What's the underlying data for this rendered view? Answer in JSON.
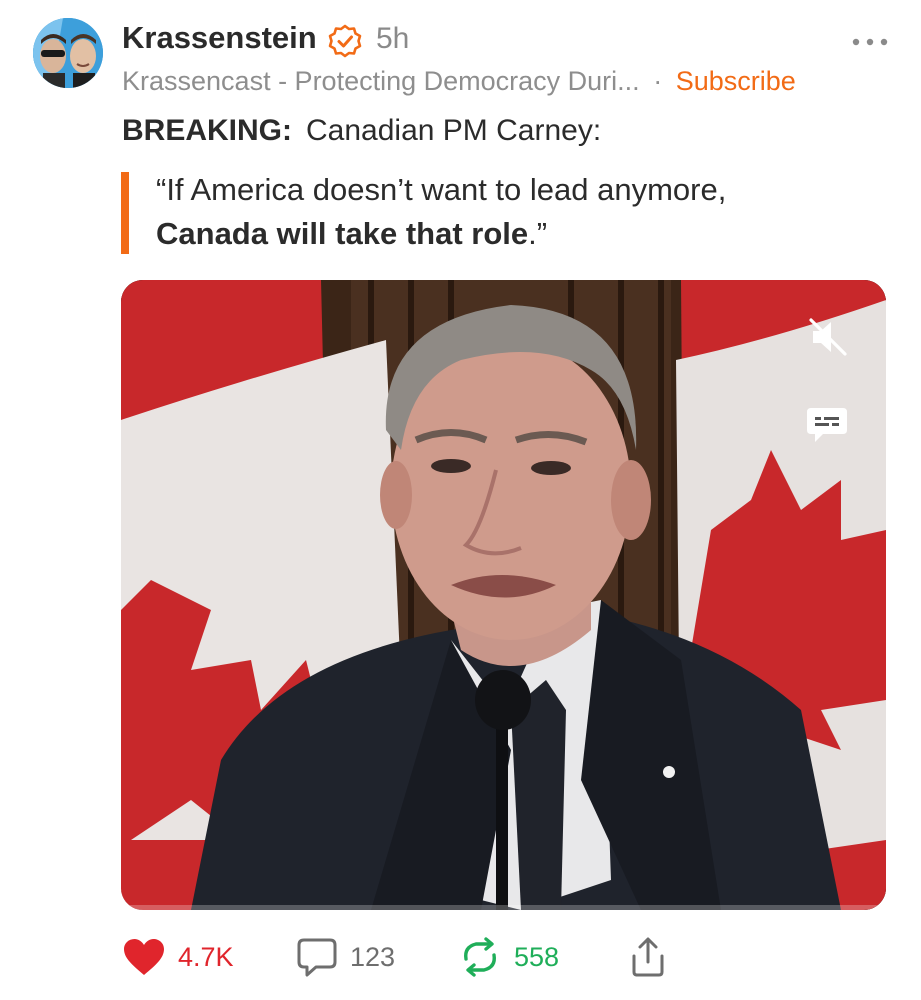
{
  "post": {
    "author": "Krassenstein",
    "time": "5h",
    "publication": "Krassencast - Protecting Democracy Duri...",
    "separator": "·",
    "subscribe_label": "Subscribe",
    "breaking_label": "BREAKING:",
    "breaking_text": "Canadian PM Carney:",
    "quote_line1": "“If America doesn’t want to lead anymore,",
    "quote_line2_bold": "Canada will take that role",
    "quote_line2_end": ".”"
  },
  "actions": {
    "likes": "4.7K",
    "comments": "123",
    "restacks": "558"
  },
  "icons": {
    "verified": "verified-check-icon",
    "more": "more-dots-icon",
    "mute": "muted-speaker-icon",
    "captions": "captions-icon",
    "like": "heart-icon",
    "comment": "comment-bubble-icon",
    "restack": "restack-arrows-icon",
    "share": "share-icon"
  },
  "colors": {
    "accent": "#f26b16",
    "like": "#e0252c",
    "restack": "#1fae59",
    "muted_text": "#8e8e8e"
  }
}
